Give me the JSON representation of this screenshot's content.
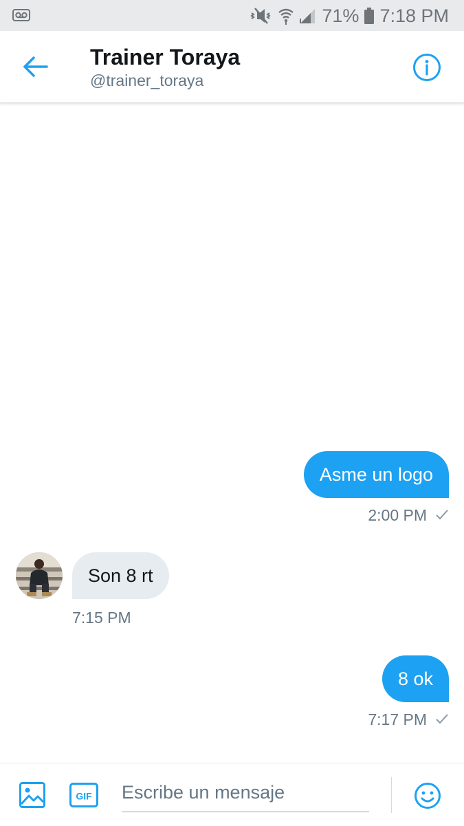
{
  "status_bar": {
    "battery": "71%",
    "time": "7:18 PM",
    "icons": [
      "voicemail-icon",
      "mute-icon",
      "wifi-icon",
      "signal-icon",
      "battery-icon"
    ]
  },
  "header": {
    "name": "Trainer Toraya",
    "handle": "@trainer_toraya",
    "icons": [
      "back-arrow-icon",
      "info-icon"
    ]
  },
  "messages": [
    {
      "direction": "outgoing",
      "text": "Asme un logo",
      "time": "2:00 PM",
      "status_icon": "check-icon"
    },
    {
      "direction": "incoming",
      "text": "Son 8 rt",
      "time": "7:15 PM"
    },
    {
      "direction": "outgoing",
      "text": "8 ok",
      "time": "7:17 PM",
      "status_icon": "check-icon"
    }
  ],
  "composer": {
    "placeholder": "Escribe un mensaje",
    "gif_label": "GIF",
    "icons": [
      "image-icon",
      "gif-icon",
      "emoji-icon"
    ]
  },
  "colors": {
    "accent": "#1da1f2",
    "incoming_bubble": "#e6ecf0",
    "secondary_text": "#657786",
    "status_bar_bg": "#e8eaec"
  }
}
